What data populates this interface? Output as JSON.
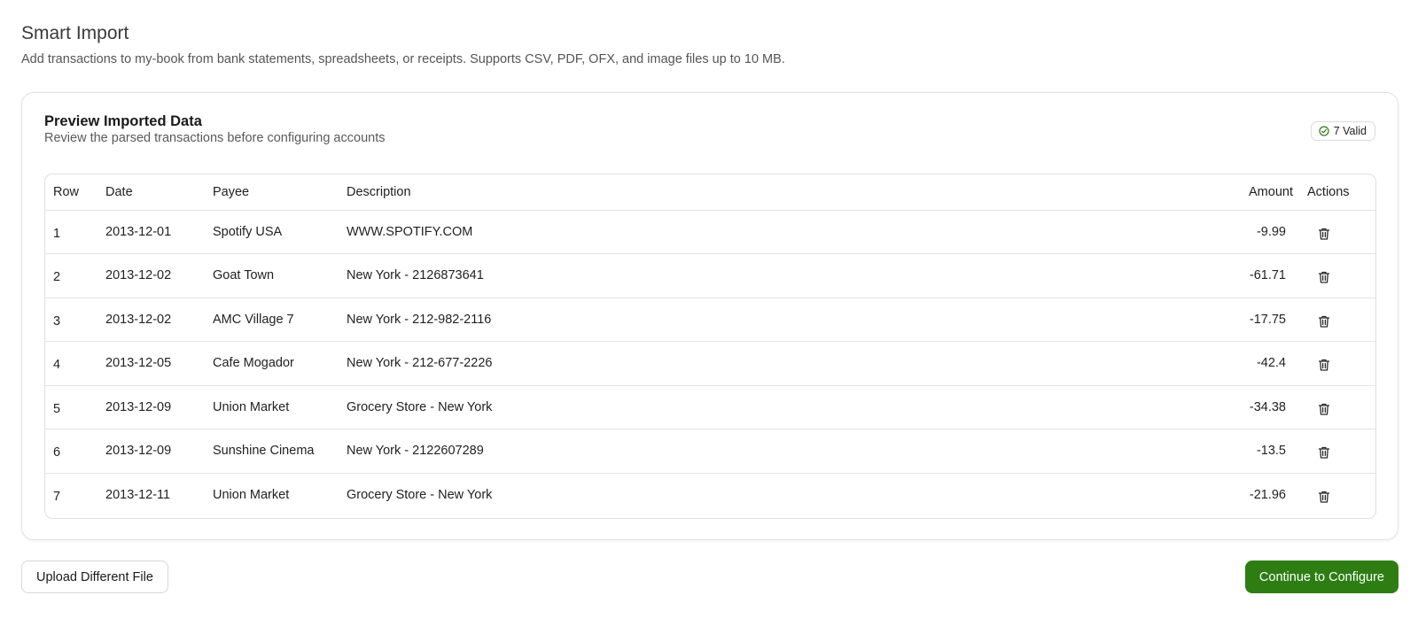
{
  "header": {
    "title": "Smart Import",
    "subtitle": "Add transactions to my-book from bank statements, spreadsheets, or receipts. Supports CSV, PDF, OFX, and image files up to 10 MB."
  },
  "preview": {
    "title": "Preview Imported Data",
    "subtitle": "Review the parsed transactions before configuring accounts",
    "badge": {
      "label": "7 Valid",
      "icon": "check-circle-icon",
      "color": "#2d7d13"
    },
    "columns": {
      "row": "Row",
      "date": "Date",
      "payee": "Payee",
      "description": "Description",
      "amount": "Amount",
      "actions": "Actions"
    },
    "rows": [
      {
        "row": "1",
        "date": "2013-12-01",
        "payee": "Spotify USA",
        "description": "WWW.SPOTIFY.COM",
        "amount": "-9.99"
      },
      {
        "row": "2",
        "date": "2013-12-02",
        "payee": "Goat Town",
        "description": "New York - 2126873641",
        "amount": "-61.71"
      },
      {
        "row": "3",
        "date": "2013-12-02",
        "payee": "AMC Village 7",
        "description": "New York - 212-982-2116",
        "amount": "-17.75"
      },
      {
        "row": "4",
        "date": "2013-12-05",
        "payee": "Cafe Mogador",
        "description": "New York - 212-677-2226",
        "amount": "-42.4"
      },
      {
        "row": "5",
        "date": "2013-12-09",
        "payee": "Union Market",
        "description": "Grocery Store - New York",
        "amount": "-34.38"
      },
      {
        "row": "6",
        "date": "2013-12-09",
        "payee": "Sunshine Cinema",
        "description": "New York - 2122607289",
        "amount": "-13.5"
      },
      {
        "row": "7",
        "date": "2013-12-11",
        "payee": "Union Market",
        "description": "Grocery Store - New York",
        "amount": "-21.96"
      }
    ],
    "row_action_icon": "trash-icon"
  },
  "footer": {
    "upload_label": "Upload Different File",
    "continue_label": "Continue to Configure",
    "primary_color": "#2d7d13"
  }
}
